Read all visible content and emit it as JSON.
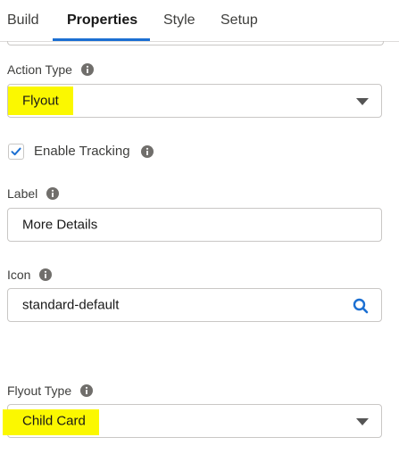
{
  "tabs": [
    "Build",
    "Properties",
    "Style",
    "Setup"
  ],
  "active_tab": "Properties",
  "action_type": {
    "label": "Action Type",
    "value": "Flyout"
  },
  "tracking": {
    "label": "Enable Tracking",
    "checked": true
  },
  "label_field": {
    "label": "Label",
    "value": "More Details"
  },
  "icon_field": {
    "label": "Icon",
    "value": "standard-default"
  },
  "flyout_type": {
    "label": "Flyout Type",
    "value": "Child Card"
  },
  "colors": {
    "accent": "#1b6fd2",
    "highlight": "#fbf800",
    "border": "#c9c7c5"
  },
  "icons": [
    "info-icon",
    "check-icon",
    "chevron-down-icon",
    "search-icon"
  ]
}
